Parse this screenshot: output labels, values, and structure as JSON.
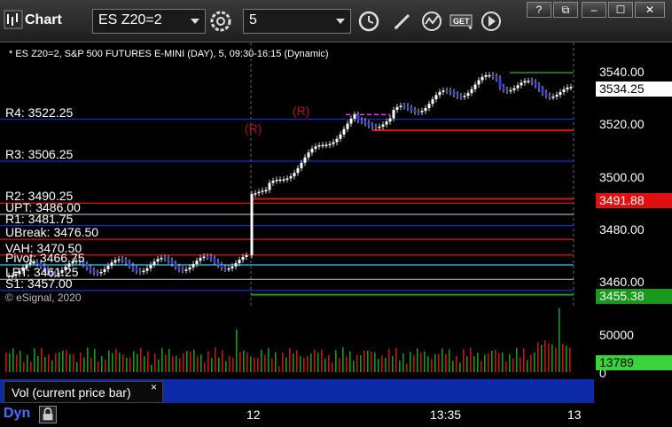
{
  "window": {
    "title": "Chart",
    "symbol": "ES Z20=2",
    "interval": "5",
    "controls": [
      "?",
      "restore",
      "min",
      "max",
      "close"
    ]
  },
  "chart_header": "* ES Z20=2, S&P 500 FUTURES E-MINI (DAY), 5, 09:30-16:15 (Dynamic)",
  "copyright": "© eSignal, 2020",
  "levels": [
    {
      "label": "R4: 3522.25",
      "price": 3522.25
    },
    {
      "label": "R3: 3506.25",
      "price": 3506.25
    },
    {
      "label": "R2: 3490.25",
      "price": 3490.25
    },
    {
      "label": "UPT: 3486.00",
      "price": 3486.0
    },
    {
      "label": "R1: 3481.75",
      "price": 3481.75
    },
    {
      "label": "UBreak: 3476.50",
      "price": 3476.5
    },
    {
      "label": "VAH: 3470.50",
      "price": 3470.5
    },
    {
      "label": "Pivot: 3466.75",
      "price": 3466.75
    },
    {
      "label": "LPT: 3461.25",
      "price": 3461.25
    },
    {
      "label": "S1: 3457.00",
      "price": 3457.0
    }
  ],
  "price_axis": {
    "ticks": [
      "3540.00",
      "3520.00",
      "3500.00",
      "3480.00",
      "3460.00"
    ],
    "current": "3534.25",
    "tag_red": "3491.88",
    "tag_green": "3455.38"
  },
  "volume_axis": {
    "ticks": [
      "50000",
      "0"
    ],
    "current": "13789"
  },
  "legend": {
    "label": "Vol (current price bar)",
    "close": "×"
  },
  "time_axis": {
    "labels": [
      "12",
      "13:35",
      "13"
    ],
    "dyn": "Dyn"
  },
  "annotations": [
    "(R)",
    "(R)"
  ],
  "colors": {
    "up": "#ffffff",
    "down": "#2b3bff",
    "magenta": "#ff30ff",
    "green": "#1fa01f",
    "red": "#e01010",
    "blue_line": "#1a2bd6"
  }
}
